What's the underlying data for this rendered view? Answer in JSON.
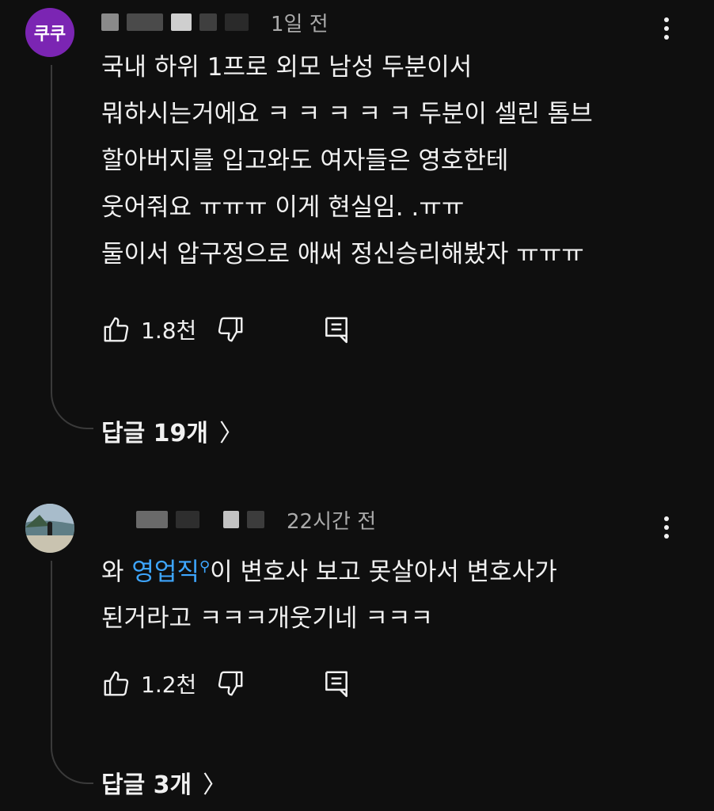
{
  "comments": [
    {
      "avatar_text": "쿠쿠",
      "avatar_color": "#7b25b3",
      "time": "1일 전",
      "lines": [
        "국내 하위 1프로 외모 남성 두분이서",
        "뭐하시는거에요 ㅋ ㅋ ㅋ ㅋ ㅋ 두분이 셀린 톰브",
        "할아버지를 입고와도 여자들은 영호한테",
        "웃어줘요 ㅠㅠㅠ 이게 현실임. .ㅠㅠ",
        "둘이서 압구정으로 애써 정신승리해봤자 ㅠㅠㅠ"
      ],
      "likes": "1.8천",
      "replies": "답글 19개"
    },
    {
      "avatar_text": "",
      "time": "22시간 전",
      "line1_prefix": "와 ",
      "mention": "영업직",
      "line1_suffix": "이 변호사 보고 못살아서 변호사가",
      "line2": "된거라고 ㅋㅋㅋ개웃기네 ㅋㅋㅋ",
      "likes": "1.2천",
      "replies": "답글 3개"
    }
  ],
  "icons": {
    "like": "thumbs-up-icon",
    "dislike": "thumbs-down-icon",
    "reply": "reply-comment-icon",
    "more": "more-vertical-icon",
    "chevron": "chevron-right-icon",
    "mention": "search-icon"
  },
  "colors": {
    "background": "#0f0f0f",
    "text": "#f1f1f1",
    "secondary": "#aaaaaa",
    "link": "#3ea6ff"
  }
}
